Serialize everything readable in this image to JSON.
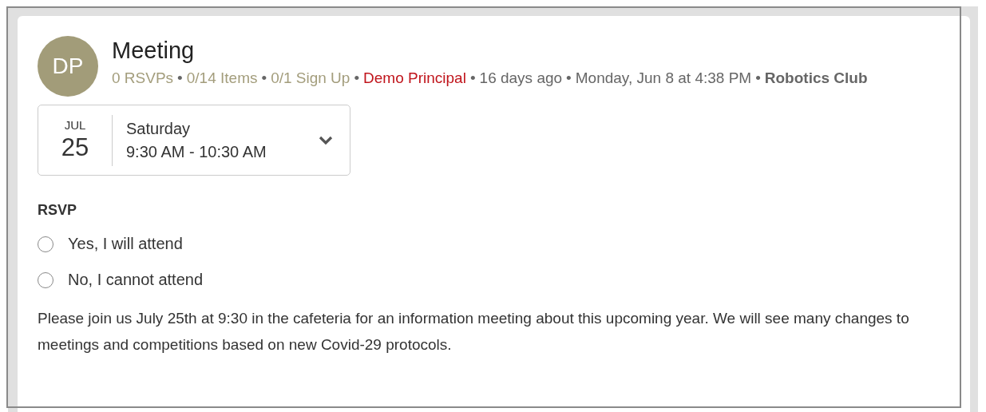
{
  "post": {
    "avatar": "DP",
    "title": "Meeting",
    "meta": [
      {
        "kind": "count",
        "text": "0 RSVPs"
      },
      {
        "kind": "separator",
        "text": "•"
      },
      {
        "kind": "count",
        "text": "0/14 Items"
      },
      {
        "kind": "separator",
        "text": "•"
      },
      {
        "kind": "count",
        "text": "0/1 Sign Up"
      },
      {
        "kind": "separator",
        "text": "•"
      },
      {
        "kind": "author",
        "text": "Demo Principal"
      },
      {
        "kind": "separator",
        "text": "•"
      },
      {
        "kind": "plain",
        "text": "16 days ago"
      },
      {
        "kind": "separator",
        "text": "•"
      },
      {
        "kind": "plain",
        "text": "Monday, Jun 8 at 4:38 PM"
      },
      {
        "kind": "separator",
        "text": "•"
      },
      {
        "kind": "group",
        "text": "Robotics Club"
      }
    ]
  },
  "event": {
    "month": "JUL",
    "day": "25",
    "weekday": "Saturday",
    "time": "9:30 AM - 10:30 AM",
    "expanded": false
  },
  "rsvp": {
    "heading": "RSVP",
    "options": [
      {
        "label": "Yes, I will attend",
        "selected": false
      },
      {
        "label": "No, I cannot attend",
        "selected": false
      }
    ]
  },
  "description": "Please join us July 25th at 9:30 in the cafeteria for an information meeting about this upcoming year. We will see many changes to meetings and competitions based on new Covid-29 protocols."
}
